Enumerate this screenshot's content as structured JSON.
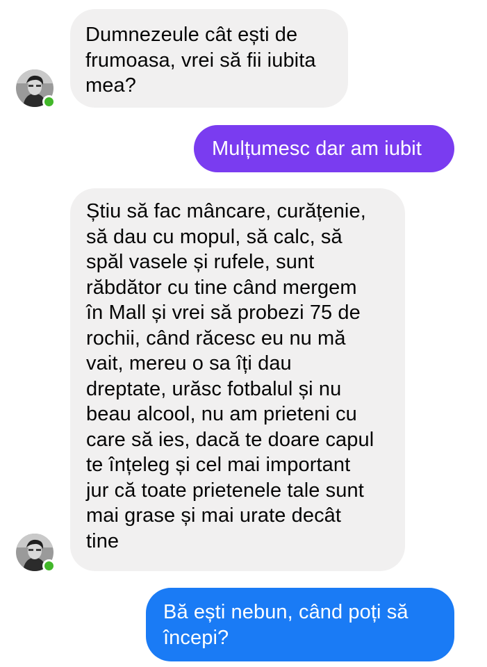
{
  "conversation": {
    "messages": [
      {
        "id": "m1",
        "direction": "incoming",
        "text": "Dumnezeule cât ești de\nfrumoasa, vrei să fii iubita\nmea?",
        "show_avatar": true
      },
      {
        "id": "m2",
        "direction": "outgoing",
        "text": "Mulțumesc dar am iubit",
        "bubble_color": "#7a3cf0"
      },
      {
        "id": "m3",
        "direction": "incoming",
        "text": "Știu să fac mâncare, curățenie,\nsă dau cu mopul, să calc, să\nspăl vasele și rufele, sunt\nrăbdător cu tine când mergem\nîn Mall și vrei să probezi 75 de\nrochii, când răcesc eu nu mă\nvait, mereu o sa îți dau\ndreptate, urăsc fotbalul și nu\nbeau alcool, nu am prieteni cu\ncare să ies, dacă te doare capul\nte înțeleg și cel mai important\njur că toate prietenele tale sunt\nmai grase și mai urate decât\ntine",
        "show_avatar": true
      },
      {
        "id": "m4",
        "direction": "outgoing",
        "text": "Bă ești nebun, când poți să\nîncepi?",
        "bubble_color": "#1a7bf5"
      }
    ]
  },
  "avatar": {
    "icon": "user-photo-icon",
    "online_indicator_color": "#42b72a"
  },
  "colors": {
    "incoming_bubble": "#f1f0f0",
    "incoming_text": "#050505",
    "outgoing_text": "#ffffff",
    "background": "#ffffff"
  }
}
